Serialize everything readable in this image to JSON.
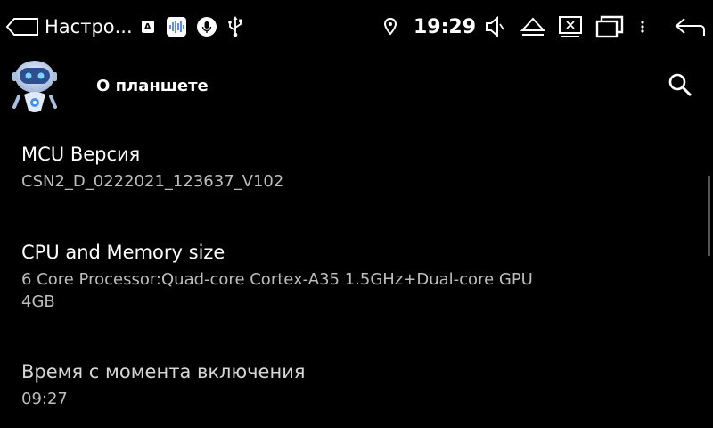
{
  "status_bar": {
    "app_title": "Настро...",
    "time": "19:29",
    "badge_letter": "A",
    "icons": [
      "home-outline-icon",
      "a-badge-icon",
      "voice-assistant-icon",
      "microphone-icon",
      "usb-icon",
      "location-pin-icon",
      "volume-icon",
      "eject-icon",
      "close-screen-icon",
      "recent-apps-icon",
      "more-vert-icon",
      "back-icon"
    ]
  },
  "header": {
    "title": "О планшете",
    "icons": [
      "robot-avatar-icon",
      "search-icon"
    ]
  },
  "items": [
    {
      "title": "MCU Версия",
      "subtitle": "CSN2_D_0222021_123637_V102"
    },
    {
      "title": "CPU and Memory size",
      "subtitle": "6 Core Processor:Quad-core Cortex-A35 1.5GHz+Dual-core GPU\n4GB"
    },
    {
      "title": "Время с момента включения",
      "subtitle": "09:27"
    }
  ],
  "colors": {
    "background": "#000000",
    "text": "#ffffff",
    "subtext": "#bdbdbd",
    "accent": "#4a90e2"
  }
}
